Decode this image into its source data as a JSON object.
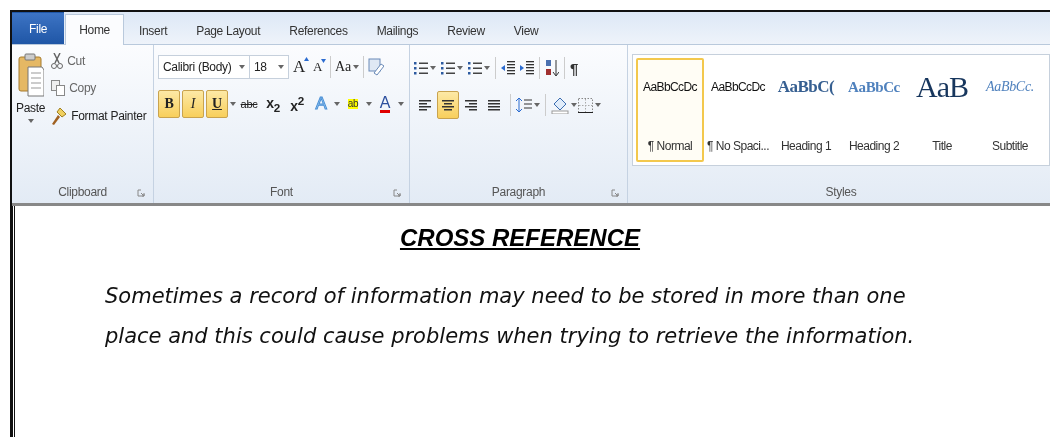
{
  "tabs": [
    {
      "label": "File",
      "kind": "file",
      "selected": false
    },
    {
      "label": "Home",
      "kind": "tab",
      "selected": true
    },
    {
      "label": "Insert",
      "kind": "tab",
      "selected": false
    },
    {
      "label": "Page Layout",
      "kind": "tab",
      "selected": false
    },
    {
      "label": "References",
      "kind": "tab",
      "selected": false
    },
    {
      "label": "Mailings",
      "kind": "tab",
      "selected": false
    },
    {
      "label": "Review",
      "kind": "tab",
      "selected": false
    },
    {
      "label": "View",
      "kind": "tab",
      "selected": false
    }
  ],
  "clipboard": {
    "paste": "Paste",
    "cut": "Cut",
    "copy": "Copy",
    "format_painter": "Format Painter",
    "label": "Clipboard"
  },
  "font": {
    "font_name": "Calibri (Body)",
    "font_size": "18",
    "grow": "A",
    "shrink": "A",
    "change_case": "Aa",
    "label": "Font",
    "format_buttons": [
      {
        "kind": "bold",
        "label": "B",
        "on": true
      },
      {
        "kind": "italic",
        "label": "I",
        "on": true
      },
      {
        "kind": "underline",
        "label": "U",
        "on": true
      },
      {
        "kind": "strike",
        "label": "abc",
        "on": false
      },
      {
        "kind": "subscript",
        "label": "x$_{2}$",
        "on": false
      },
      {
        "kind": "superscript",
        "label": "x$^{2}$",
        "on": false
      },
      {
        "kind": "effects",
        "label": "A",
        "on": false
      },
      {
        "kind": "highlight",
        "label": "ab",
        "on": false
      },
      {
        "kind": "color",
        "label": "A",
        "on": false
      }
    ]
  },
  "paragraph": {
    "show_marks": "¶",
    "label": "Paragraph",
    "alignment": [
      {
        "kind": "left",
        "selected": false
      },
      {
        "kind": "center",
        "selected": true
      },
      {
        "kind": "right",
        "selected": false
      },
      {
        "kind": "justify",
        "selected": false
      }
    ]
  },
  "styles": {
    "label": "Styles",
    "items": [
      {
        "sample": "AaBbCcDc",
        "name": "¶ Normal",
        "kind": "normal",
        "selected": true
      },
      {
        "sample": "AaBbCcDc",
        "name": "¶ No Spaci...",
        "kind": "nospacing",
        "selected": false
      },
      {
        "sample": "AaBbC(",
        "name": "Heading 1",
        "kind": "heading1",
        "selected": false
      },
      {
        "sample": "AaBbCc",
        "name": "Heading 2",
        "kind": "heading2",
        "selected": false
      },
      {
        "sample": "AaB",
        "name": "Title",
        "kind": "title",
        "selected": false
      },
      {
        "sample": "AaBbCc.",
        "name": "Subtitle",
        "kind": "subtitle",
        "selected": false
      }
    ]
  },
  "document": {
    "heading": "CROSS REFERENCE",
    "paragraph": "Sometimes a record of information may need to be stored in more than one place and this could cause problems when trying to retrieve the information."
  }
}
